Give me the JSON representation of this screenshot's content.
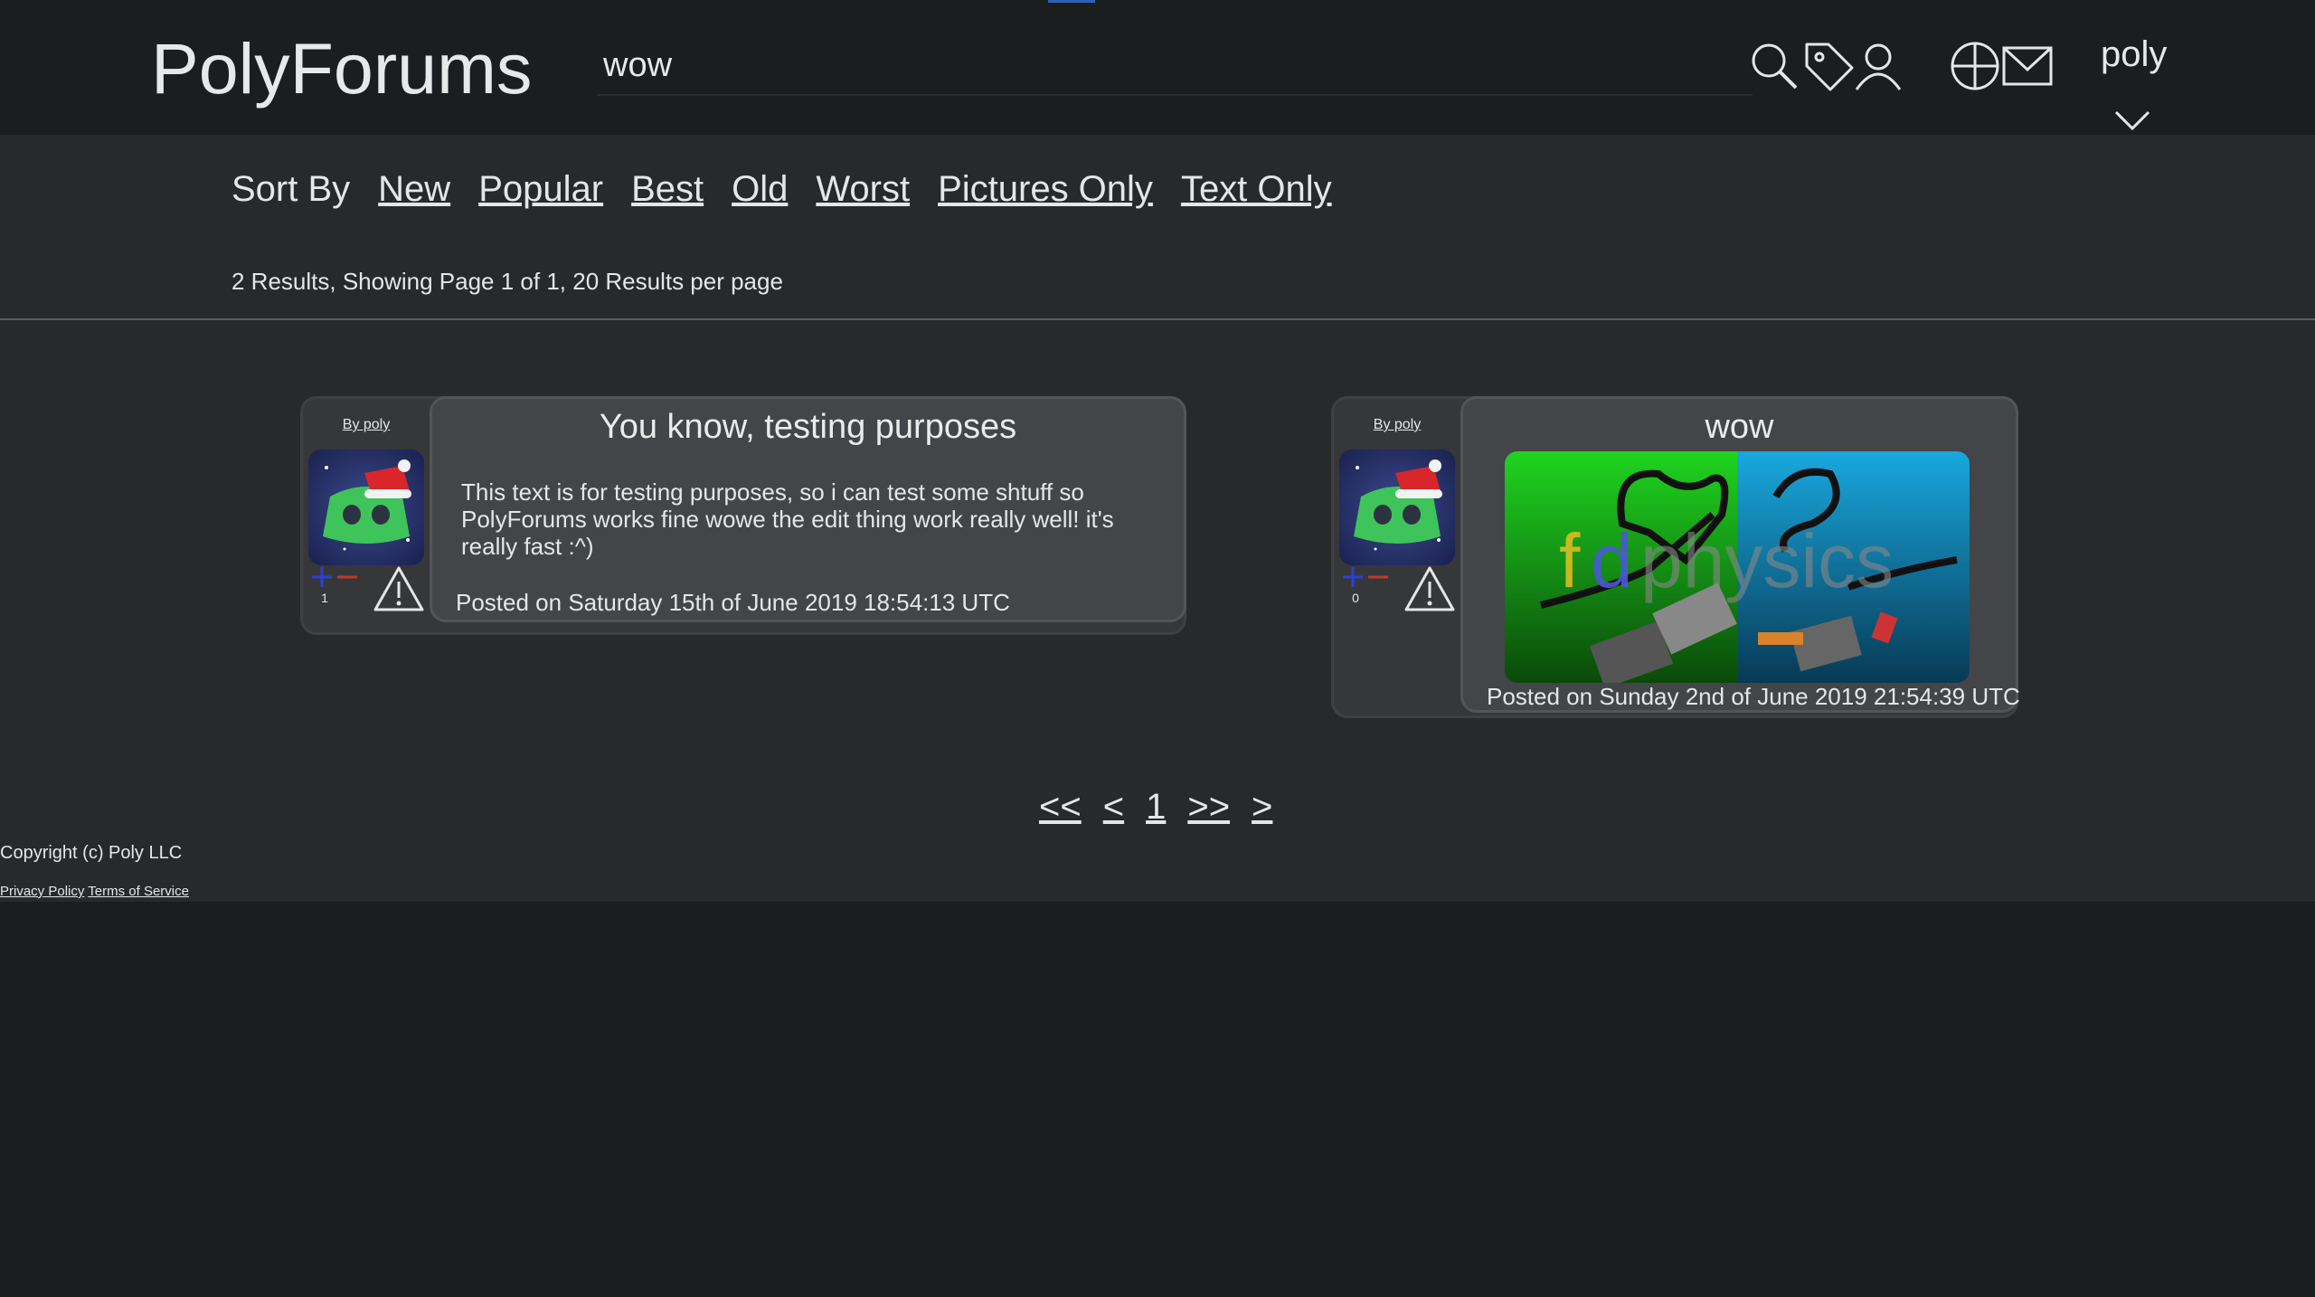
{
  "header": {
    "logo": "PolyForums",
    "search_value": "wow",
    "username": "poly"
  },
  "sort": {
    "label": "Sort By",
    "options": [
      "New",
      "Popular",
      "Best",
      "Old",
      "Worst",
      "Pictures Only",
      "Text Only"
    ]
  },
  "results_text": "2 Results, Showing Page 1 of 1, 20 Results per page",
  "posts": [
    {
      "author": "By poly",
      "score": "1",
      "title": "You know, testing purposes",
      "body": "This text is for testing purposes, so i can test some shtuff so PolyForums works fine wowe the edit thing work really well! it's really fast :^)",
      "posted": "Posted on Saturday 15th of June 2019 18:54:13 UTC"
    },
    {
      "author": "By poly",
      "score": "0",
      "title": "wow",
      "image_caption": "fdphysics",
      "posted": "Posted on Sunday 2nd of June 2019 21:54:39 UTC"
    }
  ],
  "pager": {
    "first": "<<",
    "prev": "<",
    "current": "1",
    "last": ">>",
    "next": ">"
  },
  "footer": {
    "copyright": "Copyright (c) Poly LLC",
    "privacy": "Privacy Policy",
    "terms": "Terms of Service"
  },
  "colors": {
    "background": "#1d1e20",
    "panel": "#27292b",
    "card": "#353739",
    "content": "#434548",
    "accent": "#2a64b8",
    "upvote": "#2d3fd6",
    "downvote": "#c0392b",
    "avatar_green": "#3ec45a"
  },
  "icons": [
    "search-icon",
    "tag-icon",
    "user-icon",
    "create-post-icon",
    "mail-icon",
    "chevron-down-icon",
    "upvote-icon",
    "downvote-icon",
    "report-icon"
  ]
}
